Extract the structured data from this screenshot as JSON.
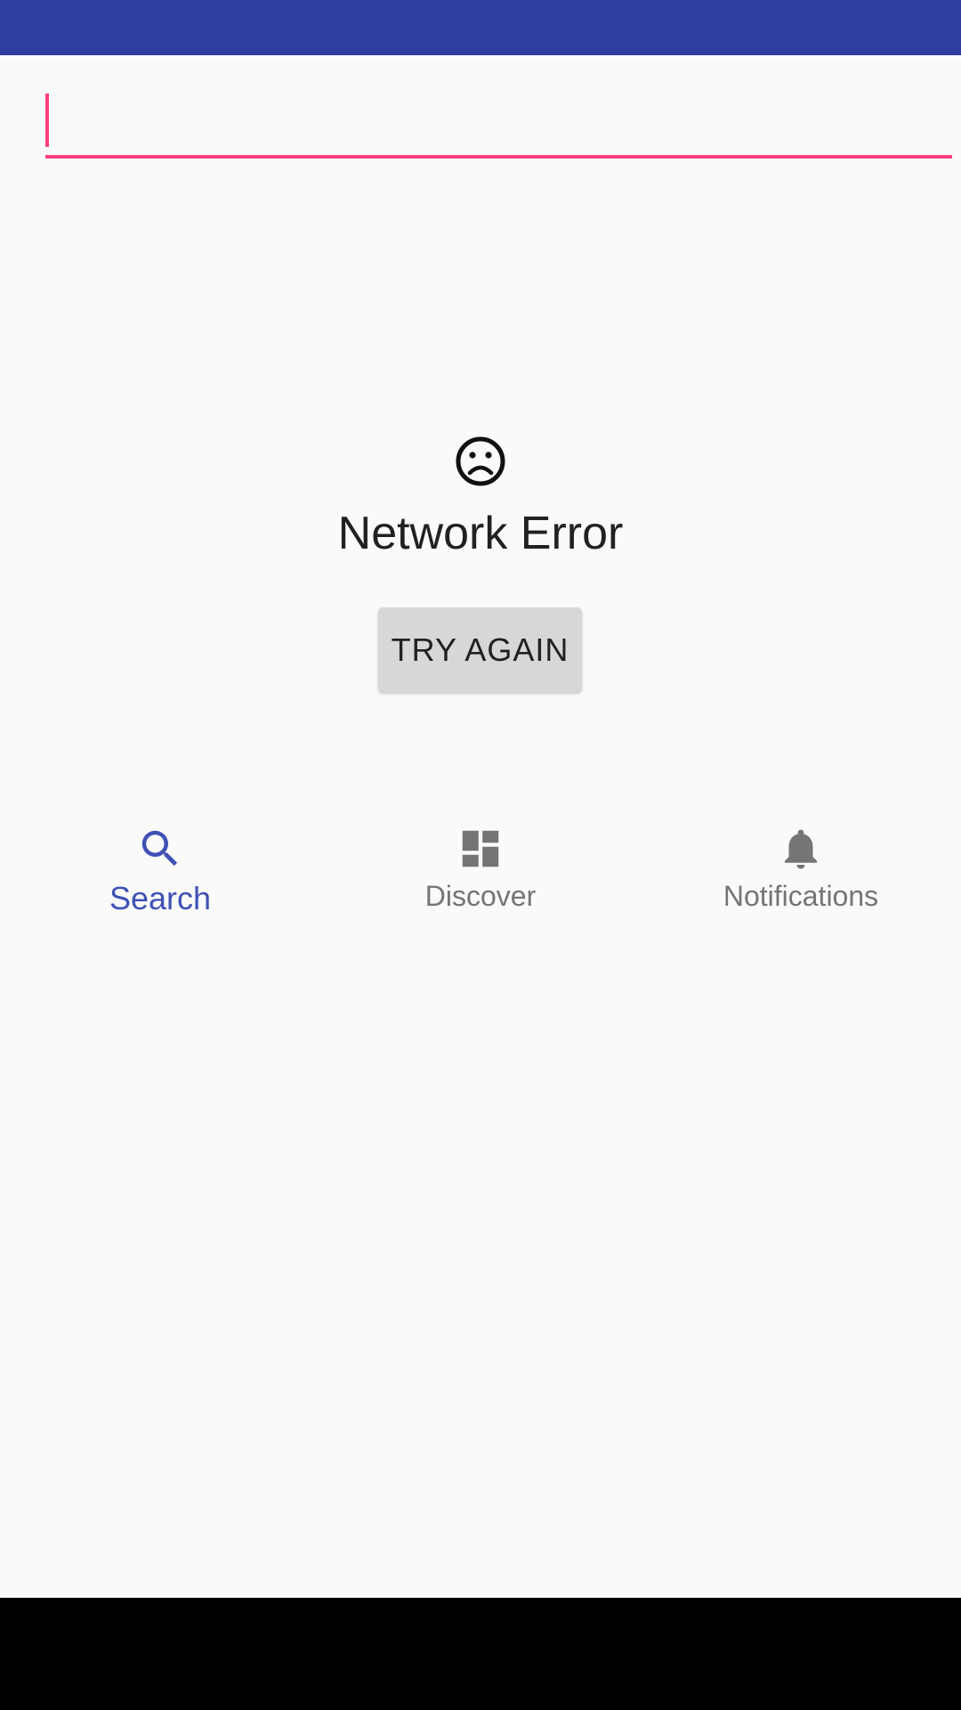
{
  "search": {
    "value": "",
    "placeholder": ""
  },
  "error": {
    "icon": "sad-face-icon",
    "title": "Network Error",
    "retry_label": "TRY AGAIN"
  },
  "bottom_nav": {
    "items": [
      {
        "label": "Search",
        "icon": "search-icon",
        "active": true
      },
      {
        "label": "Discover",
        "icon": "dashboard-icon",
        "active": false
      },
      {
        "label": "Notifications",
        "icon": "bell-icon",
        "active": false
      }
    ]
  },
  "colors": {
    "status_bar": "#303f9f",
    "accent": "#ff4081",
    "primary": "#3f51b5",
    "inactive": "#757575",
    "background": "#fafafa"
  }
}
